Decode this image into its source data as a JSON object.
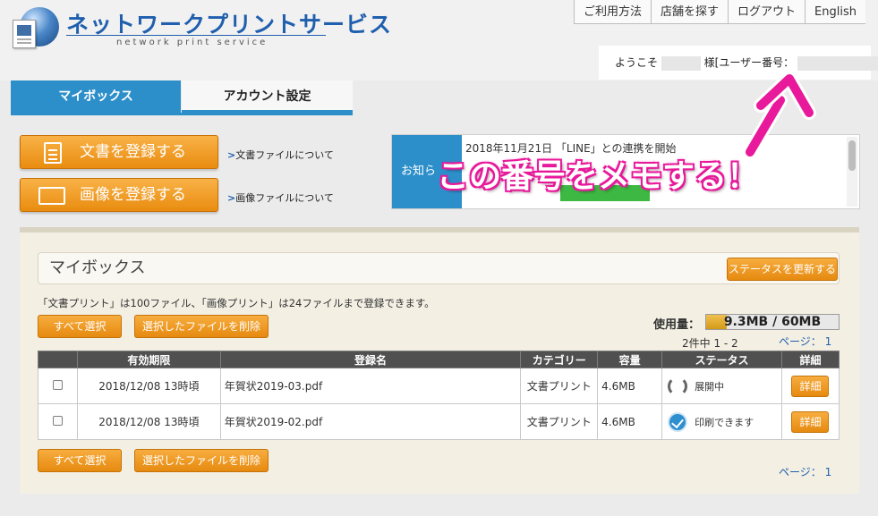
{
  "header": {
    "logo_title": "ネットワークプリントサービス",
    "logo_sub": "network print service",
    "nav": [
      "ご利用方法",
      "店舗を探す",
      "ログアウト",
      "English"
    ],
    "welcome_prefix": "ようこそ",
    "welcome_mid": "様[ユーザー番号：",
    "welcome_suffix": "]"
  },
  "tabs": {
    "mybox": "マイボックス",
    "account": "アカウント設定"
  },
  "register": {
    "doc_button": "文書を登録する",
    "img_button": "画像を登録する",
    "doc_link": "文書ファイルについて",
    "img_link": "画像ファイルについて"
  },
  "news": {
    "label": "お知ら",
    "text": "2018年11月21日 「LINE」との連携を開始"
  },
  "mybox": {
    "title": "マイボックス",
    "update_status_button": "ステータスを更新する",
    "limit_note": "「文書プリント」は100ファイル、「画像プリント」は24ファイルまで登録できます。",
    "select_all_button": "すべて選択",
    "delete_selected_button": "選択したファイルを削除",
    "usage_label": "使用量：",
    "usage_text": "9.3MB / 60MB",
    "usage_fraction": 0.155,
    "count_text": "2件中 1 - 2",
    "page_text": "ページ： 1",
    "columns": [
      "",
      "有効期限",
      "登録名",
      "カテゴリー",
      "容量",
      "ステータス",
      "詳細"
    ],
    "rows": [
      {
        "expires": "2018/12/08 13時頃",
        "name": "年賀状2019-03.pdf",
        "category": "文書プリント",
        "size": "4.6MB",
        "status": "展開中",
        "status_icon": "spinner-icon",
        "detail": "詳細"
      },
      {
        "expires": "2018/12/08 13時頃",
        "name": "年賀状2019-02.pdf",
        "category": "文書プリント",
        "size": "4.6MB",
        "status": "印刷できます",
        "status_icon": "check-circle-icon",
        "detail": "詳細"
      }
    ]
  },
  "annotation": {
    "text": "この番号をメモする！",
    "color": "#e8199a"
  }
}
